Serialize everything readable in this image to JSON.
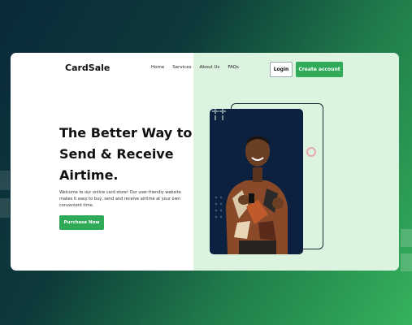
{
  "brand": {
    "name": "CardSale"
  },
  "nav": {
    "items": [
      "Home",
      "Services",
      "About Us",
      "FAQs"
    ]
  },
  "header": {
    "login_label": "Login",
    "create_label": "Create account"
  },
  "hero": {
    "headline_lines": [
      "The Better Way to",
      "Send & Receive",
      "Airtime."
    ],
    "description": "Welcome to our online card store! Our user-friendly website makes it easy to buy, send and receive airtime at your own convenient time.",
    "cta_label": "Purchase Now"
  },
  "colors": {
    "accent": "#2faa58",
    "panel_green": "#dcf3e0",
    "navy": "#0c2140",
    "bg_dark": "#0a2a3a",
    "bg_green": "#35b25c"
  },
  "icons": [
    "plus-grid-icon",
    "dot-grid-icon",
    "ring-icon"
  ]
}
